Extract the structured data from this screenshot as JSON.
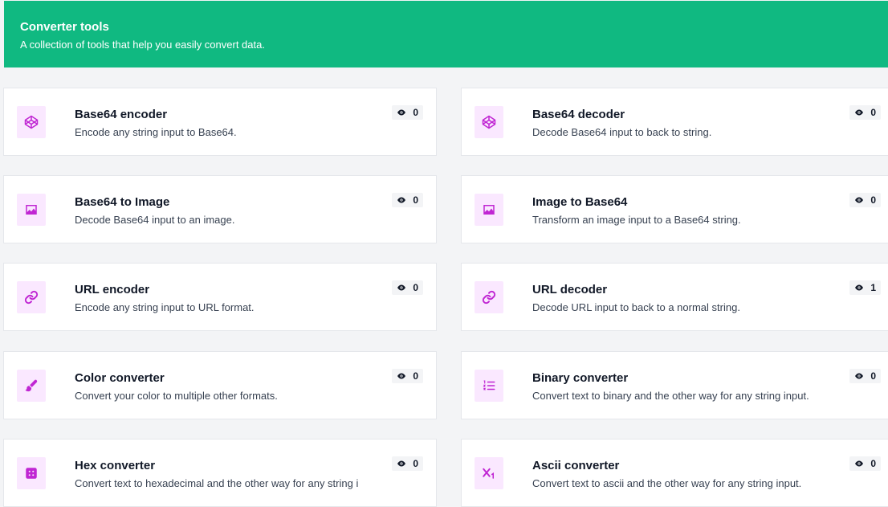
{
  "header": {
    "title": "Converter tools",
    "subtitle": "A collection of tools that help you easily convert data."
  },
  "colors": {
    "header_bg": "#10b981",
    "icon_bg": "#fae8ff",
    "icon_fg": "#c026d3"
  },
  "tools": [
    {
      "title": "Base64 encoder",
      "description": "Encode any string input to Base64.",
      "views": "0",
      "icon": "codepen-icon"
    },
    {
      "title": "Base64 decoder",
      "description": "Decode Base64 input to back to string.",
      "views": "0",
      "icon": "codepen-icon"
    },
    {
      "title": "Base64 to Image",
      "description": "Decode Base64 input to an image.",
      "views": "0",
      "icon": "image-icon"
    },
    {
      "title": "Image to Base64",
      "description": "Transform an image input to a Base64 string.",
      "views": "0",
      "icon": "image-icon"
    },
    {
      "title": "URL encoder",
      "description": "Encode any string input to URL format.",
      "views": "0",
      "icon": "link-icon"
    },
    {
      "title": "URL decoder",
      "description": "Decode URL input to back to a normal string.",
      "views": "1",
      "icon": "link-icon"
    },
    {
      "title": "Color converter",
      "description": "Convert your color to multiple other formats.",
      "views": "0",
      "icon": "paintbrush-icon"
    },
    {
      "title": "Binary converter",
      "description": "Convert text to binary and the other way for any string input.",
      "views": "0",
      "icon": "list-ordered-icon"
    },
    {
      "title": "Hex converter",
      "description": "Convert text to hexadecimal and the other way for any string i",
      "views": "0",
      "icon": "hex-grid-icon"
    },
    {
      "title": "Ascii converter",
      "description": "Convert text to ascii and the other way for any string input.",
      "views": "0",
      "icon": "subscript-icon"
    }
  ]
}
